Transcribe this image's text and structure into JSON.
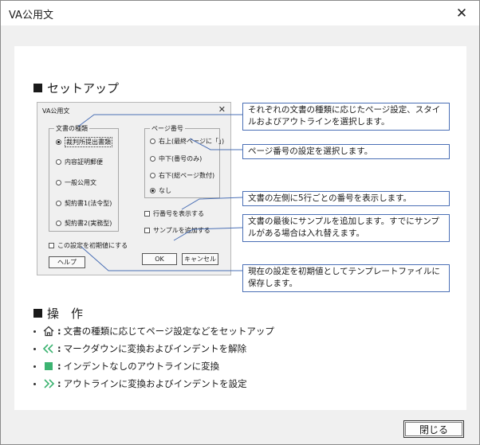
{
  "window": {
    "title": "VA公用文"
  },
  "setup": {
    "heading": "セットアップ",
    "dialog": {
      "title": "VA公用文",
      "doc_group_label": "文書の種類",
      "doc_types": [
        "裁判所提出書類",
        "内容証明郵便",
        "一般公用文",
        "契約書1(法令型)",
        "契約書2(実務型)"
      ],
      "page_group_label": "ページ番号",
      "page_options": [
        "右上(最終ページに「」)",
        "中下(番号のみ)",
        "右下(総ページ数付)",
        "なし"
      ],
      "line_numbers_label": "行番号を表示する",
      "add_sample_label": "サンプルを追加する",
      "default_label": "この設定を初期値にする",
      "help_label": "ヘルプ",
      "ok_label": "OK",
      "cancel_label": "キャンセル"
    },
    "callouts": [
      "それぞれの文書の種類に応じたページ設定、スタイルおよびアウトラインを選択します。",
      "ページ番号の設定を選択します。",
      "文書の左側に5行ごとの番号を表示します。",
      "文書の最後にサンプルを追加します。すでにサンプルがある場合は入れ替えます。",
      "現在の設定を初期値としてテンプレートファイルに保存します。"
    ]
  },
  "operations": {
    "heading": "操　作",
    "items": [
      {
        "icon": "home-icon",
        "text": "文書の種類に応じてページ設定などをセットアップ"
      },
      {
        "icon": "double-arrow-left-icon",
        "text": "マークダウンに変換およびインデントを解除"
      },
      {
        "icon": "green-square-icon",
        "text": "インデントなしのアウトラインに変換"
      },
      {
        "icon": "double-arrow-right-icon",
        "text": "アウトラインに変換およびインデントを設定"
      }
    ]
  },
  "footer": {
    "close_label": "閉じる"
  },
  "colors": {
    "callout_border": "#4a6fb5",
    "icon_green": "#3cb371"
  }
}
